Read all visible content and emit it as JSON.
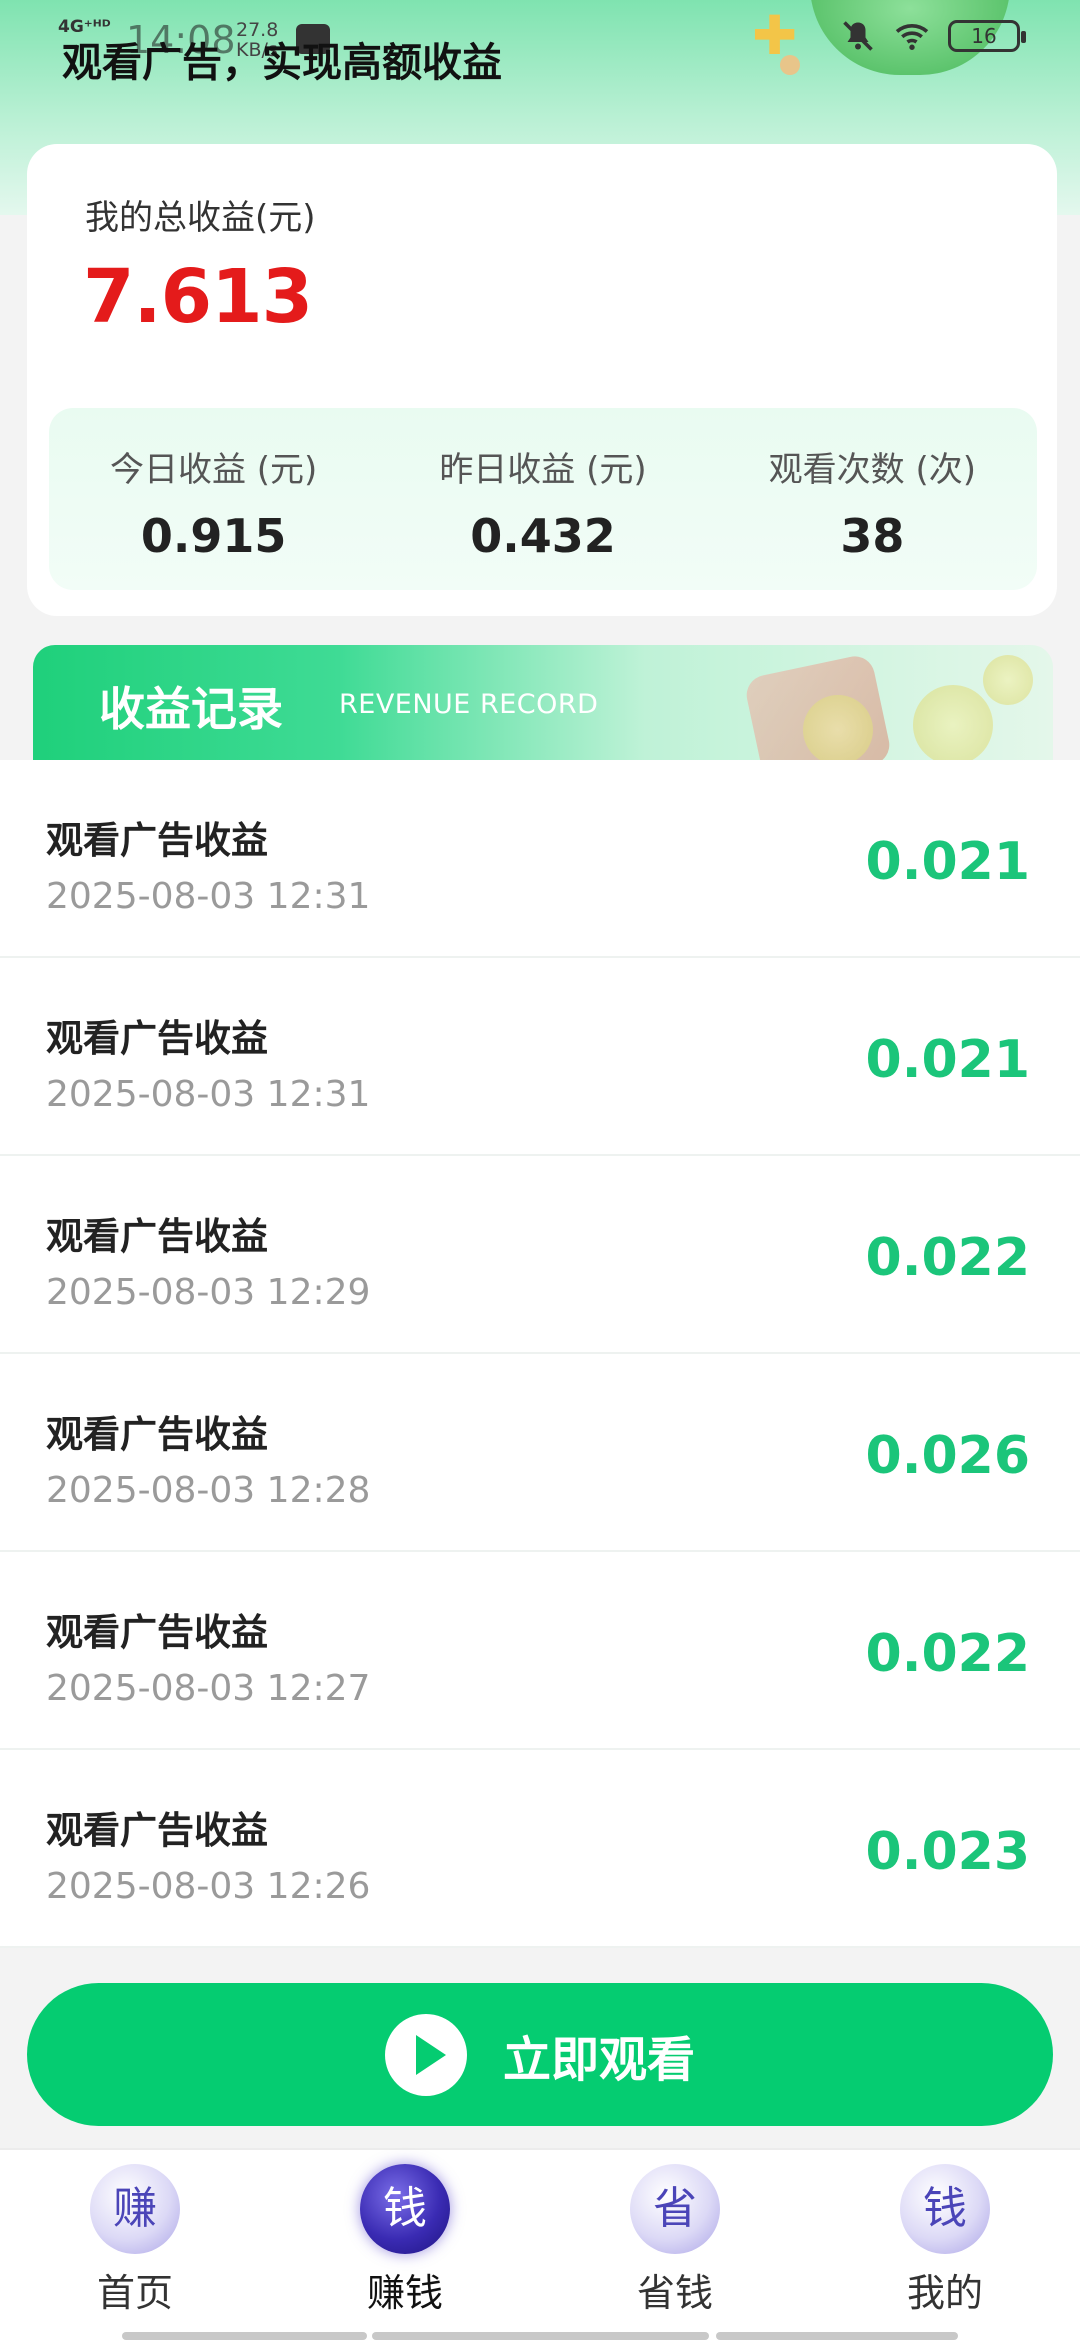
{
  "status_bar": {
    "network": "4G⁺ᴴᴰ",
    "time": "14:08",
    "speed": "27.8 KB/s",
    "battery": "16"
  },
  "page": {
    "title": "观看广告，实现高额收益"
  },
  "summary": {
    "total_label": "我的总收益(元)",
    "total_value": "7.613",
    "stats": [
      {
        "label": "今日收益 (元)",
        "value": "0.915"
      },
      {
        "label": "昨日收益 (元)",
        "value": "0.432"
      },
      {
        "label": "观看次数 (次)",
        "value": "38"
      }
    ]
  },
  "record": {
    "title": "收益记录",
    "subtitle": "REVENUE RECORD",
    "items": [
      {
        "title": "观看广告收益",
        "time": "2025-08-03 12:31",
        "amount": "0.021"
      },
      {
        "title": "观看广告收益",
        "time": "2025-08-03 12:31",
        "amount": "0.021"
      },
      {
        "title": "观看广告收益",
        "time": "2025-08-03 12:29",
        "amount": "0.022"
      },
      {
        "title": "观看广告收益",
        "time": "2025-08-03 12:28",
        "amount": "0.026"
      },
      {
        "title": "观看广告收益",
        "time": "2025-08-03 12:27",
        "amount": "0.022"
      },
      {
        "title": "观看广告收益",
        "time": "2025-08-03 12:26",
        "amount": "0.023"
      }
    ]
  },
  "watch_button": {
    "label": "立即观看",
    "icon": "play-icon"
  },
  "bottom_nav": {
    "items": [
      {
        "icon_char": "赚",
        "label": "首页",
        "active": false
      },
      {
        "icon_char": "钱",
        "label": "赚钱",
        "active": true
      },
      {
        "icon_char": "省",
        "label": "省钱",
        "active": false
      },
      {
        "icon_char": "钱",
        "label": "我的",
        "active": false
      }
    ]
  },
  "colors": {
    "accent": "#05cc71",
    "amount": "#1bc57a",
    "total": "#e41b1b",
    "nav_active": "#3a2bb3"
  }
}
